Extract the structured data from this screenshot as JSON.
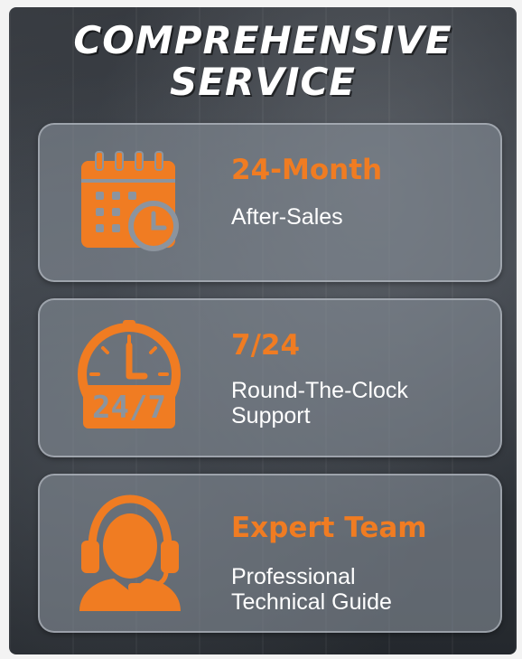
{
  "title": {
    "line1": "COMPREHENSIVE",
    "line2": "SERVICE"
  },
  "colors": {
    "accent": "#f07c22",
    "text": "#ffffff"
  },
  "cards": [
    {
      "icon": "calendar-clock-icon",
      "heading": "24-Month",
      "desc_line1": "After-Sales",
      "desc_line2": ""
    },
    {
      "icon": "stopwatch-24-7-icon",
      "heading": "7/24",
      "desc_line1": "Round-The-Clock",
      "desc_line2": "Support",
      "badge": "24/7"
    },
    {
      "icon": "headset-agent-icon",
      "heading": "Expert Team",
      "desc_line1": "Professional",
      "desc_line2": "Technical Guide"
    }
  ]
}
